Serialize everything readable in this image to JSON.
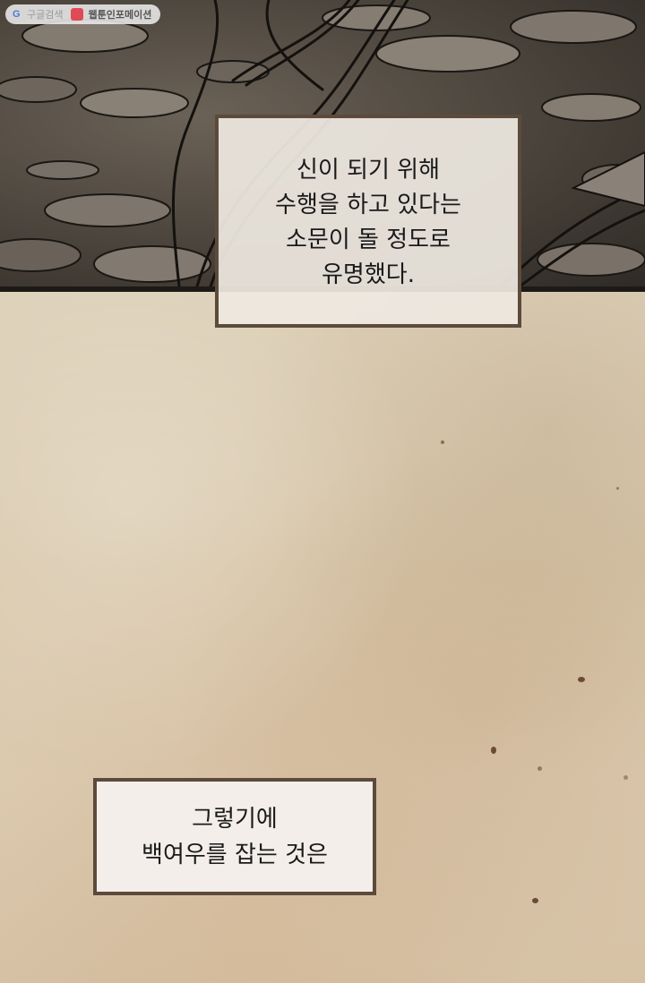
{
  "watermark": {
    "icon": "google-g-icon",
    "search_label": "구글검색",
    "badge_icon": "red-badge-icon",
    "brand_label": "웹툰인포메이션",
    "badge_color": "#e04a57"
  },
  "top_panel": {
    "description_icon": "ink-illustration-rocks-roots"
  },
  "captions": [
    {
      "lines": [
        "신이 되기 위해",
        "수행을 하고 있다는",
        "소문이 돌 정도로",
        "유명했다."
      ]
    },
    {
      "lines": [
        "그렇기에",
        "백여우를 잡는 것은"
      ]
    }
  ],
  "colors": {
    "caption_border": "#5c4a3b",
    "parchment": "#dccbb0",
    "panel_dark": "#2e2a25"
  }
}
